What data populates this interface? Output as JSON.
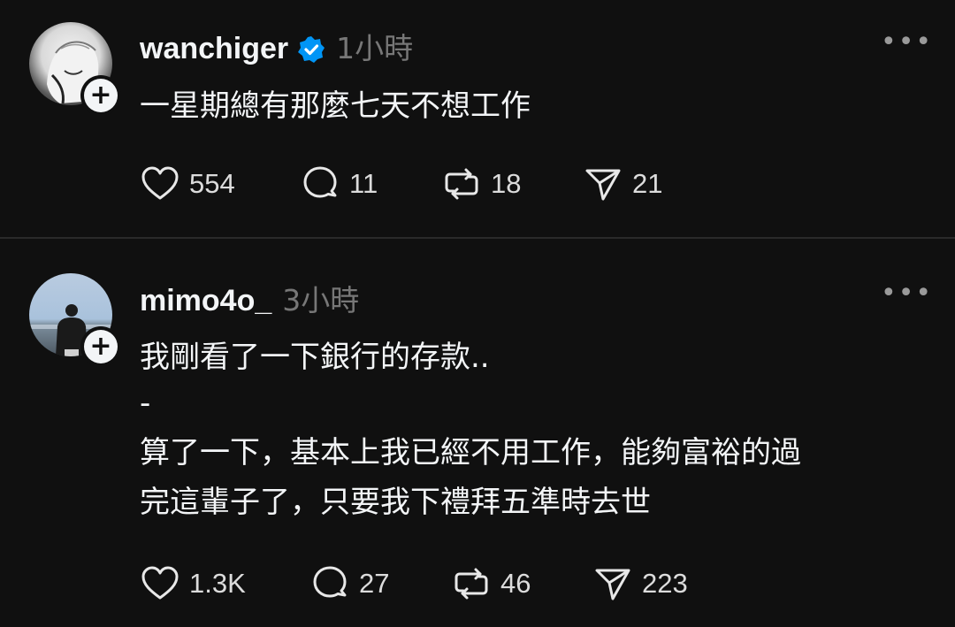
{
  "posts": [
    {
      "username": "wanchiger",
      "verified": true,
      "time": "1小時",
      "more": "•••",
      "lines": [
        "一星期總有那麼七天不想工作"
      ],
      "likes": "554",
      "replies": "11",
      "reposts": "18",
      "shares": "21"
    },
    {
      "username": "mimo4o_",
      "verified": false,
      "time": "3小時",
      "more": "•••",
      "lines": [
        "我剛看了一下銀行的存款..",
        "-",
        "算了一下，基本上我已經不用工作，能夠富裕的過",
        "完這輩子了，只要我下禮拜五準時去世"
      ],
      "likes": "1.3K",
      "replies": "27",
      "reposts": "46",
      "shares": "223"
    }
  ],
  "follow_badge": "+",
  "colors": {
    "background": "#101010",
    "text": "#f3f5f7",
    "muted": "#777777",
    "verified": "#0095f6"
  }
}
